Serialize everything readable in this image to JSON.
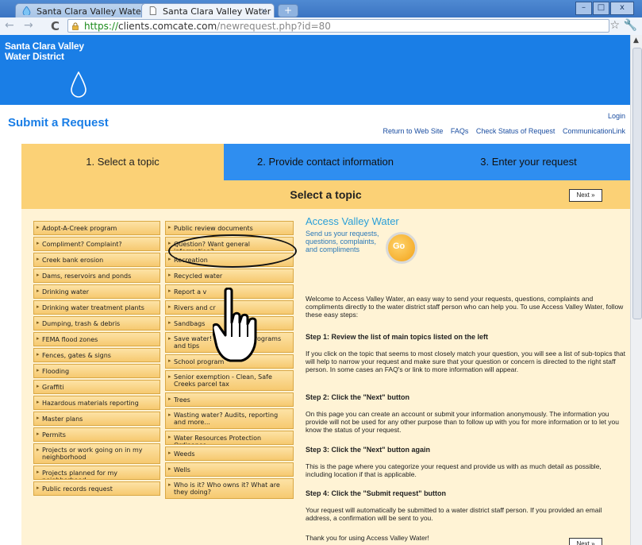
{
  "browser": {
    "tabs": [
      {
        "title": "Santa Clara Valley Water D..."
      },
      {
        "title": "Santa Clara Valley Water D..."
      }
    ],
    "url_https": "https://",
    "url_host": "clients.comcate.com",
    "url_path": "/newrequest.php?id=80"
  },
  "brand": {
    "line1": "Santa Clara Valley",
    "line2": "Water District",
    "color": "#1a7ee6"
  },
  "header": {
    "title": "Submit a Request",
    "login": "Login",
    "links": [
      "Return to Web Site",
      "FAQs",
      "Check Status of Request",
      "CommunicationLink"
    ]
  },
  "steps": [
    "1. Select a topic",
    "2. Provide contact information",
    "3. Enter your request"
  ],
  "section_title": "Select a topic",
  "next_label": "Next »",
  "topics_left": [
    "Adopt-A-Creek program",
    "Compliment? Complaint?",
    "Creek bank erosion",
    "Dams, reservoirs and ponds",
    "Drinking water",
    "Drinking water treatment plants",
    "Dumping, trash & debris",
    "FEMA flood zones",
    "Fences, gates & signs",
    "Flooding",
    "Graffiti",
    "Hazardous materials reporting",
    "Master plans",
    "Permits",
    "Projects or work going on in my neighborhood",
    "Projects planned for my neighborhood",
    "Public records request"
  ],
  "topics_right": [
    "Public review documents",
    "Question? Want general information?",
    "Recreation",
    "Recycled water",
    "Report a v",
    "Rivers and cr",
    "Sandbags",
    "Save water! Incentives, programs and tips",
    "School program",
    "Senior exemption - Clean, Safe Creeks parcel tax",
    "Trees",
    "Wasting water? Audits, reporting and more...",
    "Water Resources Protection Ordinance",
    "Weeds",
    "Wells",
    "Who is it? Who owns it? What are they doing?"
  ],
  "promo": {
    "title": "Access Valley Water",
    "line1": "Send us your requests,",
    "line2": "questions, complaints,",
    "line3": "and compliments",
    "go": "Go"
  },
  "intro": {
    "p1": "Welcome to Access Valley Water, an easy way to send your requests, questions, complaints and compliments directly to the water district staff person who can help you. To use Access Valley Water, follow these easy steps:",
    "h1": "Step 1: Review the list of main topics listed on the left",
    "p2": "If you click on the topic that seems to most closely match your question, you will see a list of sub-topics that will help to narrow your request and make sure that your question or concern is directed to the right staff person. In some cases an FAQ's or link to more information will appear.",
    "h2": "Step 2: Click the \"Next\" button",
    "p3": "On this page you can create an account or submit your information anonymously.  The information you provide will not be used for any other purpose than to follow up with you for more information or to let you know the status of your request.",
    "h3": "Step 3: Click the \"Next\" button again",
    "p4": "This is the page where you categorize your request and provide us with as much detail as possible, including location if that is applicable.",
    "h4": "Step 4: Click the \"Submit request\" button",
    "p5": "Your request will automatically be submitted to a water district staff person.  If you provided an email address, a confirmation will be sent to you.",
    "p6": "Thank you for using Access Valley Water!"
  }
}
